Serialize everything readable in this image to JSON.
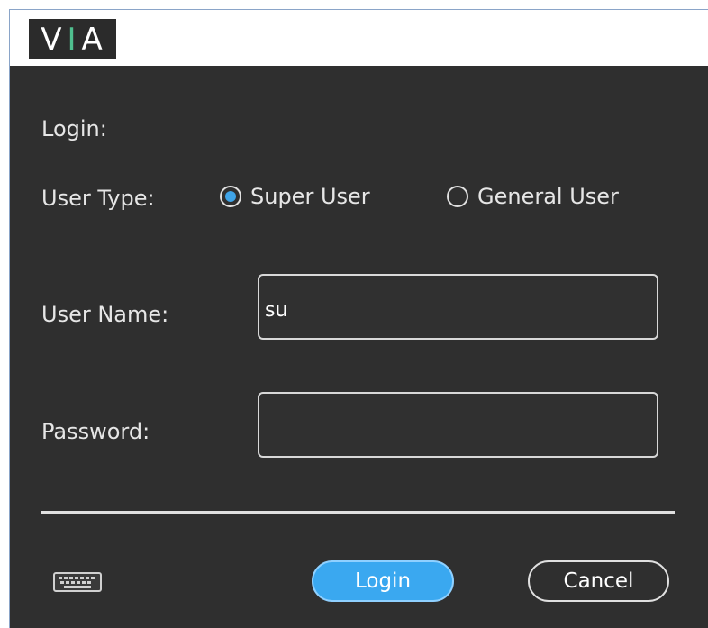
{
  "logo": {
    "left": "V",
    "mid": "I",
    "right": "A"
  },
  "login": {
    "heading": "Login:",
    "user_type_label": "User Type:",
    "user_types": [
      {
        "label": "Super User",
        "selected": true
      },
      {
        "label": "General User",
        "selected": false
      }
    ],
    "username_label": "User Name:",
    "username_value": "su",
    "password_label": "Password:",
    "password_value": "",
    "login_button": "Login",
    "cancel_button": "Cancel"
  },
  "colors": {
    "panel_bg": "#2f2f2f",
    "accent": "#3aa8f0",
    "logo_accent": "#4fbf8f"
  },
  "icons": {
    "keyboard": "keyboard-icon"
  }
}
